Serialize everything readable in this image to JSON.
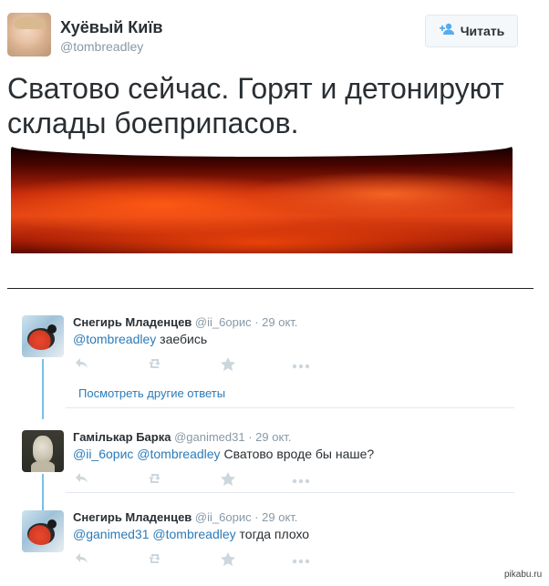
{
  "tweet": {
    "author_name": "Хуёвый Київ",
    "author_handle": "@tombreadley",
    "follow_label": "Читать",
    "follow_icon": "person-plus-icon",
    "text": "Сватово сейчас. Горят и детонируют склады боеприпасов."
  },
  "replies": [
    {
      "name": "Снегирь Младенцев",
      "handle": "@ii_6орис",
      "time": "· 29 окт.",
      "mentions": [
        "@tombreadley"
      ],
      "text": "заебись"
    },
    {
      "name": "Гамількар Барка",
      "handle": "@ganimed31",
      "time": "· 29 окт.",
      "mentions": [
        "@ii_6орис",
        "@tombreadley"
      ],
      "text": "Сватово вроде бы наше?"
    },
    {
      "name": "Снегирь Младенцев",
      "handle": "@ii_6орис",
      "time": "· 29 окт.",
      "mentions": [
        "@ganimed31",
        "@tombreadley"
      ],
      "text": "тогда плохо"
    }
  ],
  "more_replies_label": "Посмотреть другие ответы",
  "action_icons": [
    "reply-icon",
    "retweet-icon",
    "favorite-icon",
    "more-icon"
  ],
  "watermark": "pikabu.ru",
  "colors": {
    "link": "#2b7bb9",
    "accent": "#55acee",
    "muted": "#8899a6",
    "thread_line": "#7ac0e8"
  }
}
